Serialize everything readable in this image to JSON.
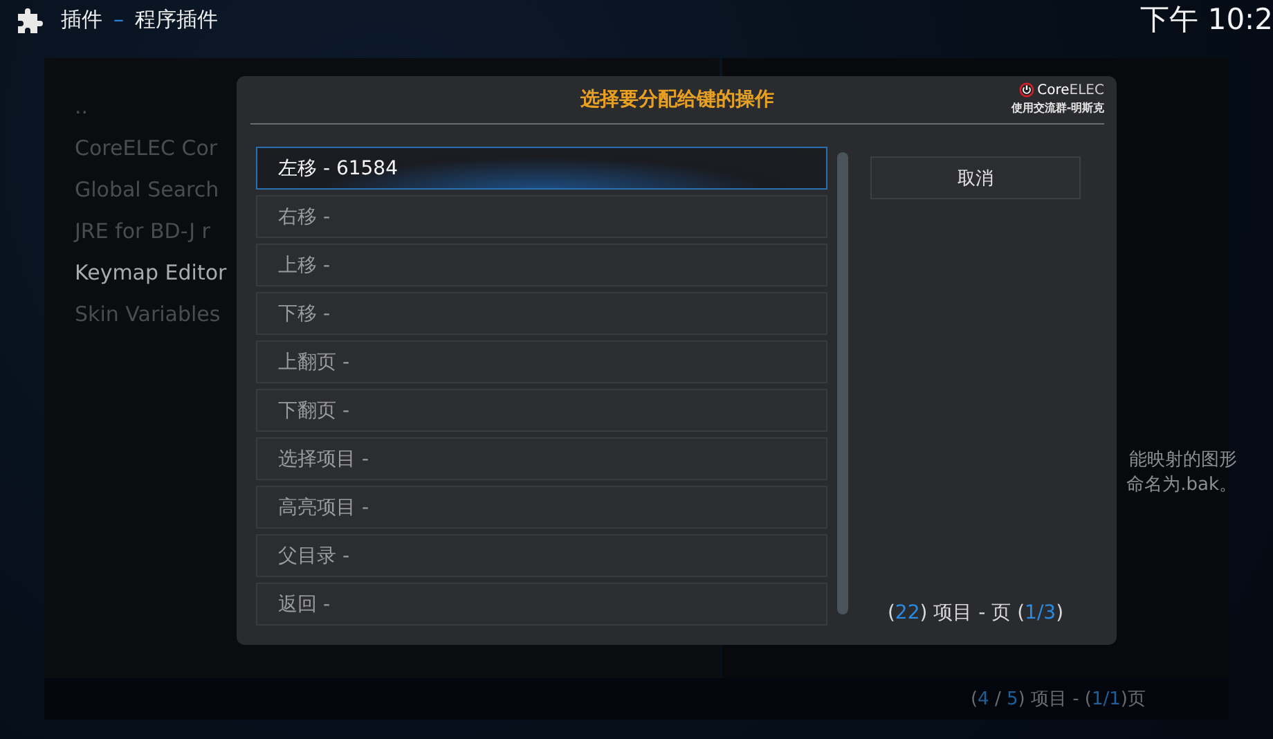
{
  "header": {
    "section": "插件",
    "separator": "–",
    "subsection": "程序插件",
    "clock": "下午 10:2"
  },
  "addon_list": [
    {
      "label": "..",
      "focused": false
    },
    {
      "label": "CoreELEC Cor",
      "focused": false
    },
    {
      "label": "Global Search",
      "focused": false
    },
    {
      "label": "JRE for BD-J r",
      "focused": false
    },
    {
      "label": "Keymap Editor",
      "focused": true
    },
    {
      "label": "Skin Variables",
      "focused": false
    }
  ],
  "description": [
    "能映射的图形",
    "命名为.bak。"
  ],
  "list_pager": [
    {
      "text": "(",
      "kind": "plain"
    },
    {
      "text": "4",
      "kind": "number"
    },
    {
      "text": " / ",
      "kind": "plain"
    },
    {
      "text": "5",
      "kind": "number"
    },
    {
      "text": ") 项目 - (",
      "kind": "plain"
    },
    {
      "text": "1/1",
      "kind": "number"
    },
    {
      "text": ")页",
      "kind": "plain"
    }
  ],
  "dialog": {
    "title": "选择要分配给键的操作",
    "logo": {
      "brand_a": "Core",
      "brand_b": "ELEC",
      "caption": "使用交流群-明斯克"
    },
    "actions": [
      {
        "label": "左移 - 61584",
        "selected": true
      },
      {
        "label": "右移 -",
        "selected": false
      },
      {
        "label": "上移 -",
        "selected": false
      },
      {
        "label": "下移 -",
        "selected": false
      },
      {
        "label": "上翻页 -",
        "selected": false
      },
      {
        "label": "下翻页 -",
        "selected": false
      },
      {
        "label": "选择项目 -",
        "selected": false
      },
      {
        "label": "高亮项目 -",
        "selected": false
      },
      {
        "label": "父目录 -",
        "selected": false
      },
      {
        "label": "返回 -",
        "selected": false
      }
    ],
    "cancel": "取消",
    "pager": [
      {
        "text": "(",
        "kind": "plain"
      },
      {
        "text": "22",
        "kind": "number"
      },
      {
        "text": ") 项目 - 页 (",
        "kind": "plain"
      },
      {
        "text": "1/3",
        "kind": "number"
      },
      {
        "text": ")",
        "kind": "plain"
      }
    ]
  }
}
